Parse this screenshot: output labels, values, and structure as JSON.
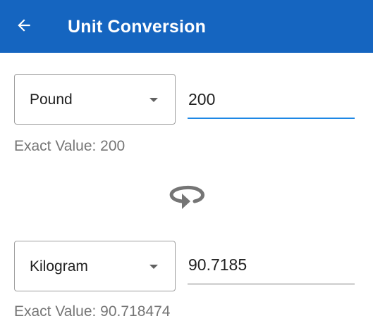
{
  "appbar": {
    "title": "Unit Conversion",
    "back_icon": "arrow-back-icon",
    "color": "#1565c0"
  },
  "from": {
    "unit": "Pound",
    "value": "200",
    "exact_label": "Exact Value: 200"
  },
  "swap": {
    "icon": "swap-rotate-icon"
  },
  "to": {
    "unit": "Kilogram",
    "value": "90.7185",
    "exact_label": "Exact Value: 90.718474"
  }
}
